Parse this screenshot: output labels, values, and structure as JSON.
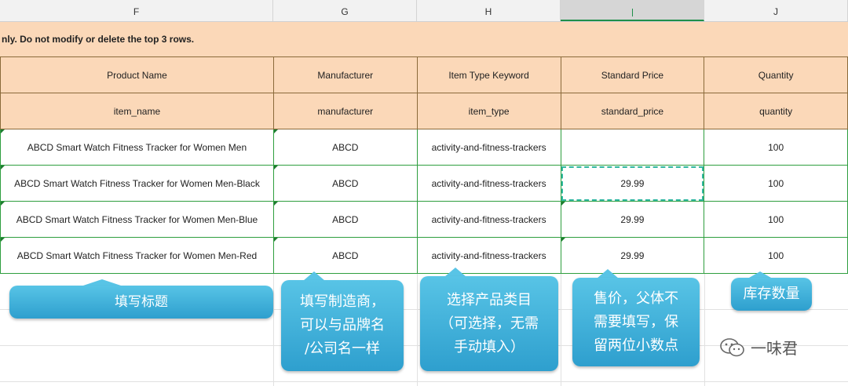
{
  "column_headers": [
    "F",
    "G",
    "H",
    "",
    "J"
  ],
  "notice": "nly. Do not modify or delete the top 3 rows.",
  "header_row_1": [
    "Product Name",
    "Manufacturer",
    "Item Type Keyword",
    "Standard Price",
    "Quantity"
  ],
  "header_row_2": [
    "item_name",
    "manufacturer",
    "item_type",
    "standard_price",
    "quantity"
  ],
  "rows": [
    [
      "ABCD Smart Watch Fitness Tracker for Women Men",
      "ABCD",
      "activity-and-fitness-trackers",
      "",
      "100"
    ],
    [
      "ABCD Smart Watch Fitness Tracker for Women Men-Black",
      "ABCD",
      "activity-and-fitness-trackers",
      "29.99",
      "100"
    ],
    [
      "ABCD Smart Watch Fitness Tracker for Women Men-Blue",
      "ABCD",
      "activity-and-fitness-trackers",
      "29.99",
      "100"
    ],
    [
      "ABCD Smart Watch Fitness Tracker for Women Men-Red",
      "ABCD",
      "activity-and-fitness-trackers",
      "29.99",
      "100"
    ]
  ],
  "callouts": {
    "title": "填写标题",
    "manufacturer": "填写制造商，\n可以与品牌名\n/公司名一样",
    "category": "选择产品类目\n（可选择，无需\n手动填入）",
    "price": "售价，父体不\n需要填写，保\n留两位小数点",
    "quantity": "库存数量"
  },
  "watermark": "一味君",
  "colors": {
    "header_fill": "#fbd8b8",
    "grid_green": "#2e9e3e",
    "callout_blue": "#2e9fce"
  }
}
